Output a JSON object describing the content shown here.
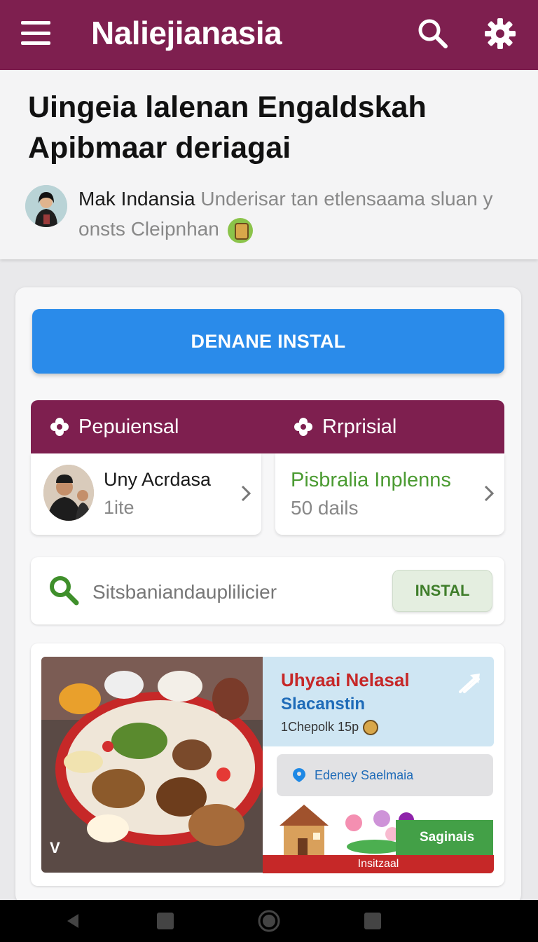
{
  "appbar": {
    "title": "Naliejianasia",
    "background_color": "#7e1f4f",
    "icons": [
      "menu-icon",
      "search-icon",
      "gear-icon"
    ]
  },
  "article": {
    "title": "Uingeia lalenan Engaldskah Apibmaar deriagai",
    "author": "Mak Indansia",
    "subtitle": "Underisar tan etlensaama sluan y onsts Cleipnhan"
  },
  "primary_button": {
    "label": "DENANE INSTAL",
    "color": "#2a8bea"
  },
  "tabs": [
    {
      "label": "Pepuiensal",
      "icon": "flower-icon"
    },
    {
      "label": "Rrprisial",
      "icon": "flower-icon"
    }
  ],
  "tiles": [
    {
      "name": "Uny Acrdasa",
      "sub": "1ite"
    },
    {
      "name": "Pisbralia Inplenns",
      "sub": "50 dails"
    }
  ],
  "search": {
    "placeholder": "Sitsbaniandauplilicier",
    "button_label": "INSTAL"
  },
  "promo": {
    "logo_text": "V",
    "headline": "Uhyaai Nelasal",
    "subhead": "Slacanstin",
    "meta": "1Chepolk 15p",
    "pill_label": "Edeney Saelmaia",
    "green_label": "Saginais",
    "red_label": "Insitzaal"
  },
  "colors": {
    "accent": "#7e1f4f",
    "primary": "#2a8bea",
    "green": "#43a047",
    "red": "#c62828"
  }
}
